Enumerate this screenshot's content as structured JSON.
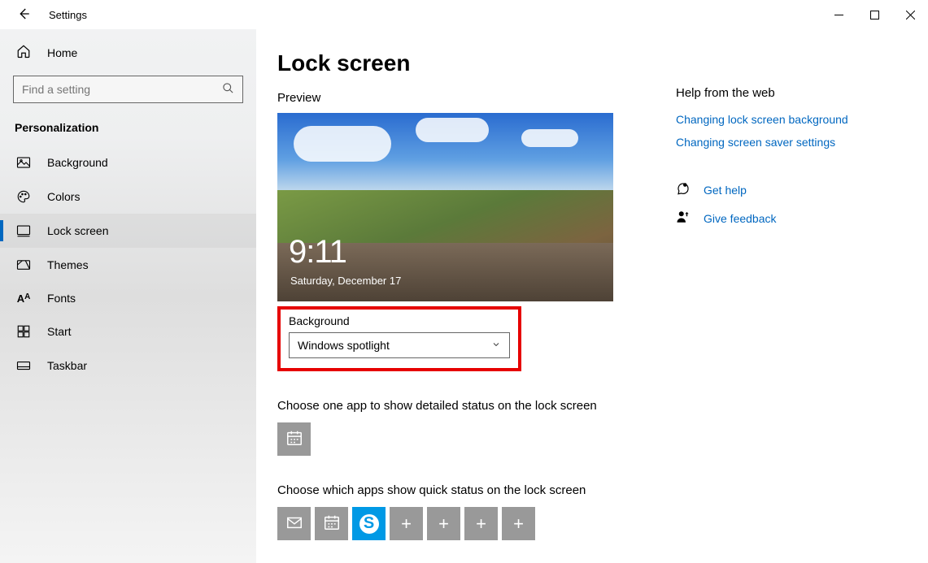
{
  "window": {
    "title": "Settings"
  },
  "sidebar": {
    "home_label": "Home",
    "search_placeholder": "Find a setting",
    "category": "Personalization",
    "items": [
      {
        "label": "Background"
      },
      {
        "label": "Colors"
      },
      {
        "label": "Lock screen"
      },
      {
        "label": "Themes"
      },
      {
        "label": "Fonts"
      },
      {
        "label": "Start"
      },
      {
        "label": "Taskbar"
      }
    ]
  },
  "page": {
    "title": "Lock screen",
    "preview_label": "Preview",
    "preview_time": "9:11",
    "preview_date": "Saturday, December 17",
    "background_label": "Background",
    "background_value": "Windows spotlight",
    "detailed_status_label": "Choose one app to show detailed status on the lock screen",
    "quick_status_label": "Choose which apps show quick status on the lock screen"
  },
  "right": {
    "help_heading": "Help from the web",
    "links": [
      "Changing lock screen background",
      "Changing screen saver settings"
    ],
    "get_help": "Get help",
    "give_feedback": "Give feedback"
  }
}
